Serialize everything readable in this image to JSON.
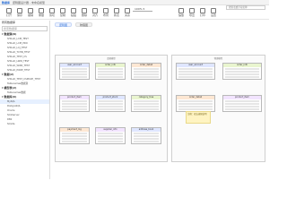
{
  "titlebar": {
    "app": "数据库",
    "title": "逻辑图设计器 - 未命名模型"
  },
  "toolbar": {
    "buttons": [
      {
        "icon": "open-icon",
        "label": "打开"
      },
      {
        "icon": "save-icon",
        "label": "保存"
      },
      {
        "icon": "undo-icon",
        "label": "撤销"
      },
      {
        "icon": "redo-icon",
        "label": "重做"
      },
      {
        "icon": "cut-icon",
        "label": "剪切"
      },
      {
        "icon": "copy-icon",
        "label": "复制"
      },
      {
        "icon": "paste-icon",
        "label": "粘贴"
      },
      {
        "icon": "delete-icon",
        "label": "删除"
      },
      {
        "icon": "align-icon",
        "label": "对齐"
      },
      {
        "icon": "layout-icon",
        "label": "布局"
      },
      {
        "icon": "table-icon",
        "label": "新表"
      },
      {
        "icon": "relation-icon",
        "label": "关系"
      },
      {
        "icon": "zoom-icon",
        "label": "缩放"
      },
      {
        "icon": "export-icon",
        "label": "导出"
      },
      {
        "icon": "print-icon",
        "label": "打印"
      },
      {
        "icon": "settings-icon",
        "label": "设置"
      }
    ],
    "zoom_select": "100% ▾",
    "search_placeholder": "搜索表或字段名称"
  },
  "sidebar": {
    "header": "所有数据库",
    "search_placeholder": "搜索数据库",
    "groups": [
      {
        "label": "数据源(8)",
        "items": [
          "SHILLD_LCM_TEST",
          "SHILLD_LCM_PRO",
          "SHILLD_LCJ_TEST",
          "SHILLD_TCHN_TEST",
          "SHILLD_TEST_CS",
          "SHILLD_LWIR_TEST",
          "SHILLD_WIR0_TEST",
          "SHILLD_PORE_TEST"
        ]
      },
      {
        "label": "数据(2)",
        "items": [
          "SHILLD_TEST_CSMULTI_TEST",
          "Tablenames数据源"
        ]
      },
      {
        "label": "模型表(2)",
        "items": [
          "Tablenames数据"
        ]
      },
      {
        "label": "数据库(6)",
        "items": [
          "MySQL",
          "PostgreSQL",
          "Oracle",
          "SQLServer",
          "DB2",
          "SQLite"
        ]
      }
    ],
    "selected": "MySQL"
  },
  "canvas": {
    "tabs": [
      "逻辑图",
      "物理图"
    ],
    "diagram_left_title": "逻辑模型",
    "diagram_right_title": "物理模型",
    "tables_left": [
      "user_account",
      "order_info",
      "order_detail",
      "product_item",
      "product_stock",
      "category_tree",
      "payment_log",
      "supplier_info",
      "address_book"
    ],
    "tables_right": [
      "user_account",
      "order_info",
      "order_detail",
      "product_item"
    ],
    "note": "注释：双击编辑说明"
  }
}
